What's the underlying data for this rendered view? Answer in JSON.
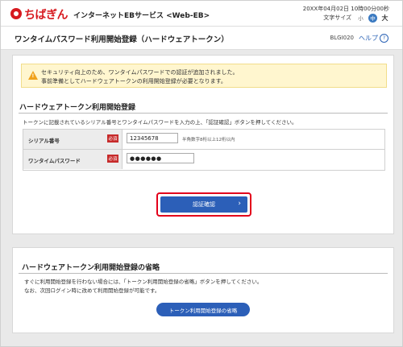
{
  "header": {
    "logo_text": "ちばぎん",
    "service_name": "インターネットEBサービス <Web-EB>",
    "datetime": "20XX年04月02日 10時00分00秒",
    "font_size_label": "文字サイズ",
    "font_sizes": [
      "小",
      "中",
      "大"
    ]
  },
  "titlebar": {
    "title": "ワンタイムパスワード利用開始登録（ハードウェアトークン）",
    "screen_id": "BLGI020",
    "help_label": "ヘルプ",
    "help_icon": "?"
  },
  "notice": {
    "line1": "セキュリティ向上のため、ワンタイムパスワードでの認証が追加されました。",
    "line2": "事前準備としてハードウェアトークンの利用開始登録が必要となります。"
  },
  "registration": {
    "heading": "ハードウェアトークン利用開始登録",
    "instructions": "トークンに記載されているシリアル番号とワンタイムパスワードを入力の上、「認証確認」ボタンを押してください。",
    "serial_label": "シリアル番号",
    "serial_value": "12345678",
    "serial_hint": "半角数字8桁以上12桁以内",
    "otp_label": "ワンタイムパスワード",
    "otp_value": "●●●●●●",
    "required_badge": "必須",
    "confirm_button": "認証確認",
    "confirm_chevron": "›"
  },
  "skip": {
    "heading": "ハードウェアトークン利用開始登録の省略",
    "line1": "すぐに利用開始登録を行わない場合には、「トークン利用開始登録の省略」ボタンを押してください。",
    "line2": "なお、次回ログイン時に改めて利用開始登録が可能です。",
    "button": "トークン利用開始登録の省略"
  },
  "colors": {
    "brand_red": "#d7191f",
    "button_blue": "#2c5fb8",
    "highlight_red": "#e3001b",
    "notice_bg": "#fff6cf"
  }
}
